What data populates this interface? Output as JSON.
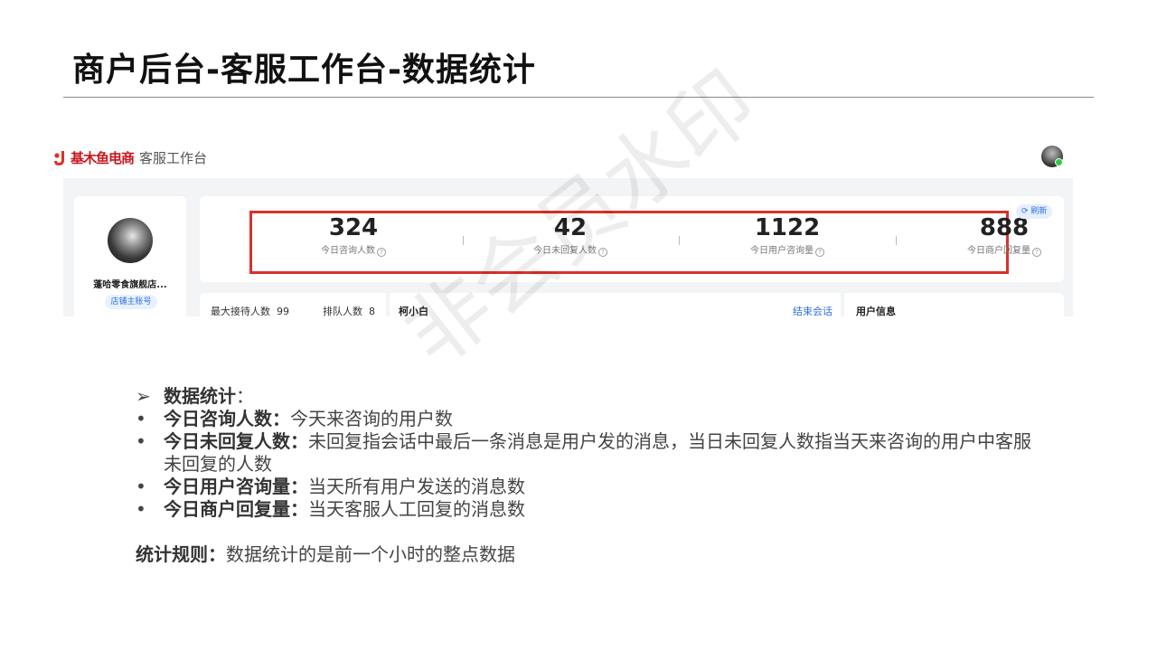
{
  "slide": {
    "title": "商户后台-客服工作台-数据统计"
  },
  "app": {
    "brand": "基木鱼电商",
    "workspace": "客服工作台"
  },
  "shop": {
    "name": "蓬哈零食旗舰店...",
    "badge": "店铺主账号"
  },
  "stats": {
    "refresh_label": "刷新",
    "help_glyph": "?",
    "items": [
      {
        "value": "324",
        "label": "今日咨询人数"
      },
      {
        "value": "42",
        "label": "今日未回复人数"
      },
      {
        "value": "1122",
        "label": "今日用户咨询量"
      },
      {
        "value": "888",
        "label": "今日商户回复量"
      }
    ]
  },
  "queue": {
    "max_label": "最大接待人数",
    "max_value": "99",
    "queue_label": "排队人数",
    "queue_value": "8"
  },
  "chat": {
    "customer": "柯小白",
    "end_label": "结束会话"
  },
  "user_info": {
    "title": "用户信息"
  },
  "watermark": "非会员水印",
  "notes": {
    "heading": {
      "marker": "➢",
      "bold": "数据统计",
      "text": "："
    },
    "items": [
      {
        "marker": "•",
        "bold": "今日咨询人数：",
        "text": "今天来咨询的用户数"
      },
      {
        "marker": "•",
        "bold": "今日未回复人数：",
        "text": "未回复指会话中最后一条消息是用户发的消息，当日未回复人数指当天来咨询的用户中客服未回复的人数"
      },
      {
        "marker": "•",
        "bold": "今日用户咨询量：",
        "text": "当天所有用户发送的消息数"
      },
      {
        "marker": "•",
        "bold": "今日商户回复量：",
        "text": "当天客服人工回复的消息数"
      }
    ],
    "rule": {
      "bold": "统计规则：",
      "text": "数据统计的是前一个小时的整点数据"
    }
  },
  "colors": {
    "highlight": "#d9312b",
    "brand": "#c8161d",
    "accent": "#2f6fe0",
    "online": "#2ecc40"
  }
}
